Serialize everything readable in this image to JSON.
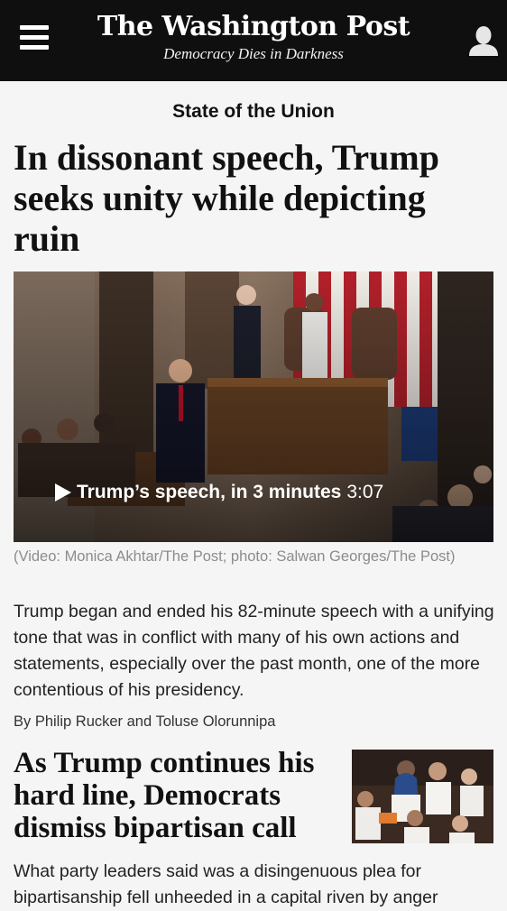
{
  "header": {
    "brand": "The Washington Post",
    "tagline": "Democracy Dies in Darkness"
  },
  "top_story": {
    "kicker": "State of the Union",
    "headline": "In dissonant speech, Trump seeks unity while depicting ruin",
    "video_title": "Trump’s speech, in 3 minutes",
    "video_duration": "3:07",
    "caption": "(Video: Monica Akhtar/The Post; photo: Salwan Georges/The Post)",
    "summary": "Trump began and ended his 82-minute speech with a unifying tone that was in conflict with many of his own actions and statements, especially over the past month, one of the more contentious of his presidency.",
    "byline": "By Philip Rucker and Toluse Olorunnipa"
  },
  "second_story": {
    "headline": "As Trump continues his hard line, Democrats dismiss bipartisan call",
    "summary": "What party leaders said was a disingenuous plea for bipartisanship fell unheeded in a capital riven by anger"
  },
  "icons": {
    "menu": "menu-icon",
    "account": "user-icon",
    "play": "play-icon"
  },
  "colors": {
    "header_bg": "#0f0f0f",
    "page_bg": "#f5f5f5",
    "caption": "#8c8c8c"
  }
}
